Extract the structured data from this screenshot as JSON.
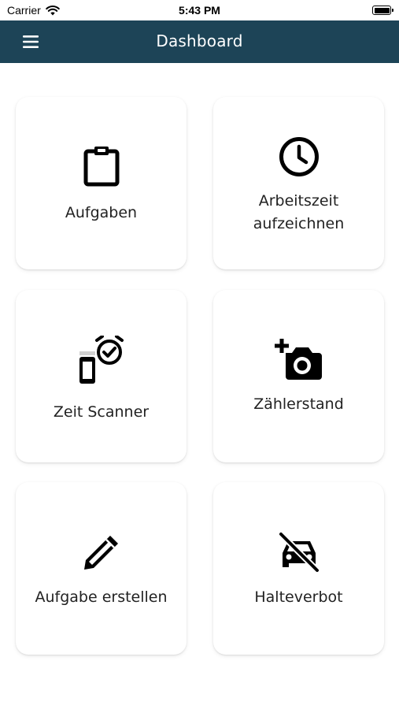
{
  "status_bar": {
    "carrier": "Carrier",
    "time": "5:43 PM"
  },
  "app_bar": {
    "title": "Dashboard",
    "menu_icon": "hamburger-menu-icon"
  },
  "colors": {
    "app_bar_background": "#1d4457",
    "app_bar_text": "#ffffff",
    "card_background": "#ffffff",
    "label_text": "#222222"
  },
  "tiles": [
    {
      "label": "Aufgaben",
      "icon": "clipboard-icon"
    },
    {
      "label": "Arbeitszeit\naufzeichnen",
      "icon": "clock-icon"
    },
    {
      "label": "Zeit Scanner",
      "icon": "phone-alarm-icon"
    },
    {
      "label": "Zählerstand",
      "icon": "add-camera-icon"
    },
    {
      "label": "Aufgabe erstellen",
      "icon": "pencil-icon"
    },
    {
      "label": "Halteverbot",
      "icon": "no-car-icon"
    }
  ]
}
